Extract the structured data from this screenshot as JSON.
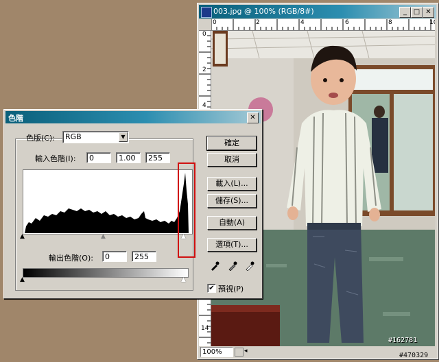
{
  "image_window": {
    "title": "003.jpg @ 100% (RGB/8#)",
    "zoom": "100%",
    "ruler_top_numbers": [
      "0",
      "2",
      "4",
      "6",
      "8",
      "10"
    ],
    "ruler_left_numbers": [
      "0",
      "2",
      "4",
      "6",
      "8",
      "10",
      "12",
      "14"
    ],
    "watermark_a": "#162781",
    "watermark_b": "#470329"
  },
  "levels_dialog": {
    "title": "色階",
    "channel_label": "色版(C):",
    "channel_value": "RGB",
    "input_label": "輸入色階(I):",
    "input_black": "0",
    "input_gamma": "1.00",
    "input_white": "255",
    "output_label": "輸出色階(O):",
    "output_black": "0",
    "output_white": "255",
    "buttons": {
      "ok": "確定",
      "cancel": "取消",
      "load": "載入(L)...",
      "save": "儲存(S)...",
      "auto": "自動(A)",
      "options": "選項(T)..."
    },
    "preview_label": "預視(P)",
    "preview_checked": "✔"
  },
  "colors": {
    "title_gradient_start": "#0a5f7a",
    "highlight": "#d01010",
    "desktop": "#a0866a"
  }
}
